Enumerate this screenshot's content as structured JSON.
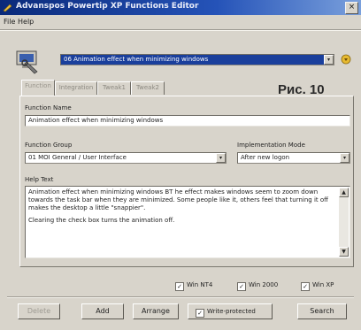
{
  "window": {
    "title": "Advanspos Powertip XP Functions Editor",
    "close_glyph": "×"
  },
  "menu": {
    "items": [
      "File",
      "Help"
    ]
  },
  "selector": {
    "value": "06 Animation effect when minimizing windows",
    "drop_glyph": "▾",
    "extra_glyph": "⯆"
  },
  "tabs": [
    "Function",
    "Integration",
    "Tweak1",
    "Tweak2"
  ],
  "figure_label": "Рис. 10",
  "function_name": {
    "label": "Function Name",
    "value": "Animation effect when minimizing windows"
  },
  "function_group": {
    "label": "Function Group",
    "value": "01 MOI General / User Interface"
  },
  "implementation_mode": {
    "label": "Implementation Mode",
    "value": "After new logon"
  },
  "help_text": {
    "label": "Help Text",
    "paragraph1": "Animation effect when minimizing windows BT he effect makes windows seem to zoom down towards the task bar when they are minimized. Some people like it, others feel that turning it off makes the desktop a little \"snappier\".",
    "paragraph2": "Clearing the check box turns the animation off."
  },
  "os_checks": [
    {
      "label": "Win NT4",
      "checked": true
    },
    {
      "label": "Win 2000",
      "checked": true
    },
    {
      "label": "Win XP",
      "checked": true
    }
  ],
  "buttons": {
    "delete": "Delete",
    "add": "Add",
    "arrange": "Arrange",
    "write_protected": "Write-protected",
    "search": "Search"
  },
  "check_glyph": "✓",
  "scroll": {
    "up": "▲",
    "down": "▼"
  }
}
